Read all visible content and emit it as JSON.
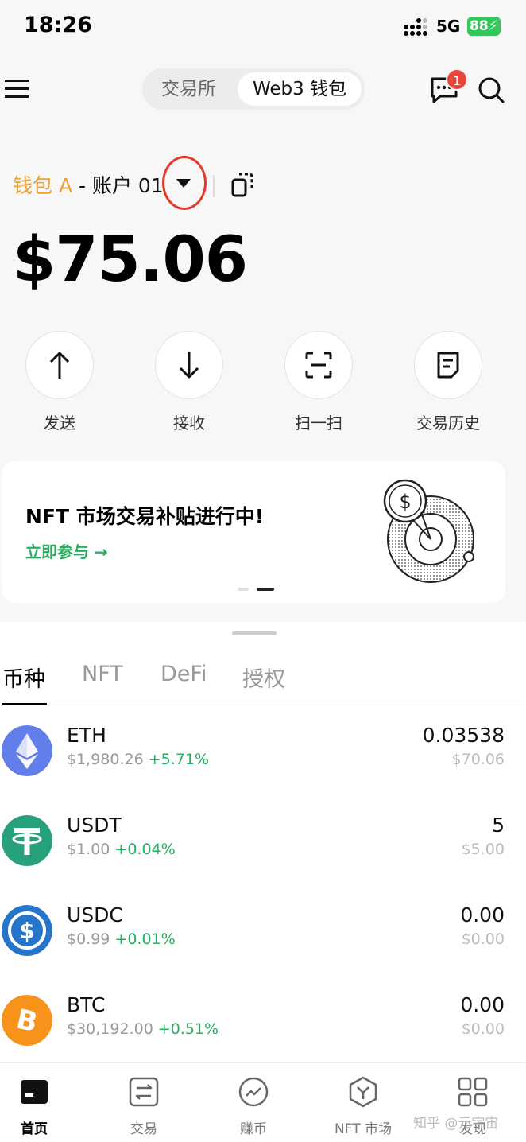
{
  "status": {
    "time": "18:26",
    "network": "5G",
    "battery": "88"
  },
  "header": {
    "segment": {
      "tab1": "交易所",
      "tab2": "Web3 钱包"
    },
    "message_badge": "1"
  },
  "wallet": {
    "name": "钱包 A",
    "separator": " - ",
    "account": "账户 01",
    "balance": "$75.06"
  },
  "actions": [
    {
      "label": "发送",
      "icon": "arrow-up-icon"
    },
    {
      "label": "接收",
      "icon": "arrow-down-icon"
    },
    {
      "label": "扫一扫",
      "icon": "scan-icon"
    },
    {
      "label": "交易历史",
      "icon": "history-icon"
    }
  ],
  "banner": {
    "title": "NFT 市场交易补贴进行中!",
    "link": "立即参与 →"
  },
  "tabs": [
    "币种",
    "NFT",
    "DeFi",
    "授权"
  ],
  "assets": [
    {
      "symbol": "ETH",
      "price": "$1,980.26",
      "change": "+5.71%",
      "amount": "0.03538",
      "value": "$70.06",
      "color": "#627eea"
    },
    {
      "symbol": "USDT",
      "price": "$1.00",
      "change": "+0.04%",
      "amount": "5",
      "value": "$5.00",
      "color": "#26a17b"
    },
    {
      "symbol": "USDC",
      "price": "$0.99",
      "change": "+0.01%",
      "amount": "0.00",
      "value": "$0.00",
      "color": "#2775ca"
    },
    {
      "symbol": "BTC",
      "price": "$30,192.00",
      "change": "+0.51%",
      "amount": "0.00",
      "value": "$0.00",
      "color": "#f7931a"
    }
  ],
  "bottom_nav": [
    {
      "label": "首页",
      "icon": "home-icon",
      "active": true
    },
    {
      "label": "交易",
      "icon": "trade-icon",
      "active": false
    },
    {
      "label": "赚币",
      "icon": "earn-icon",
      "active": false
    },
    {
      "label": "NFT 市场",
      "icon": "nft-market-icon",
      "active": false
    },
    {
      "label": "发现",
      "icon": "discover-icon",
      "active": false
    }
  ],
  "watermark": "知乎 @元宇宙",
  "colors": {
    "accent_orange": "#f0a030",
    "positive_green": "#27ae60",
    "highlight_red": "#e53a2a"
  }
}
